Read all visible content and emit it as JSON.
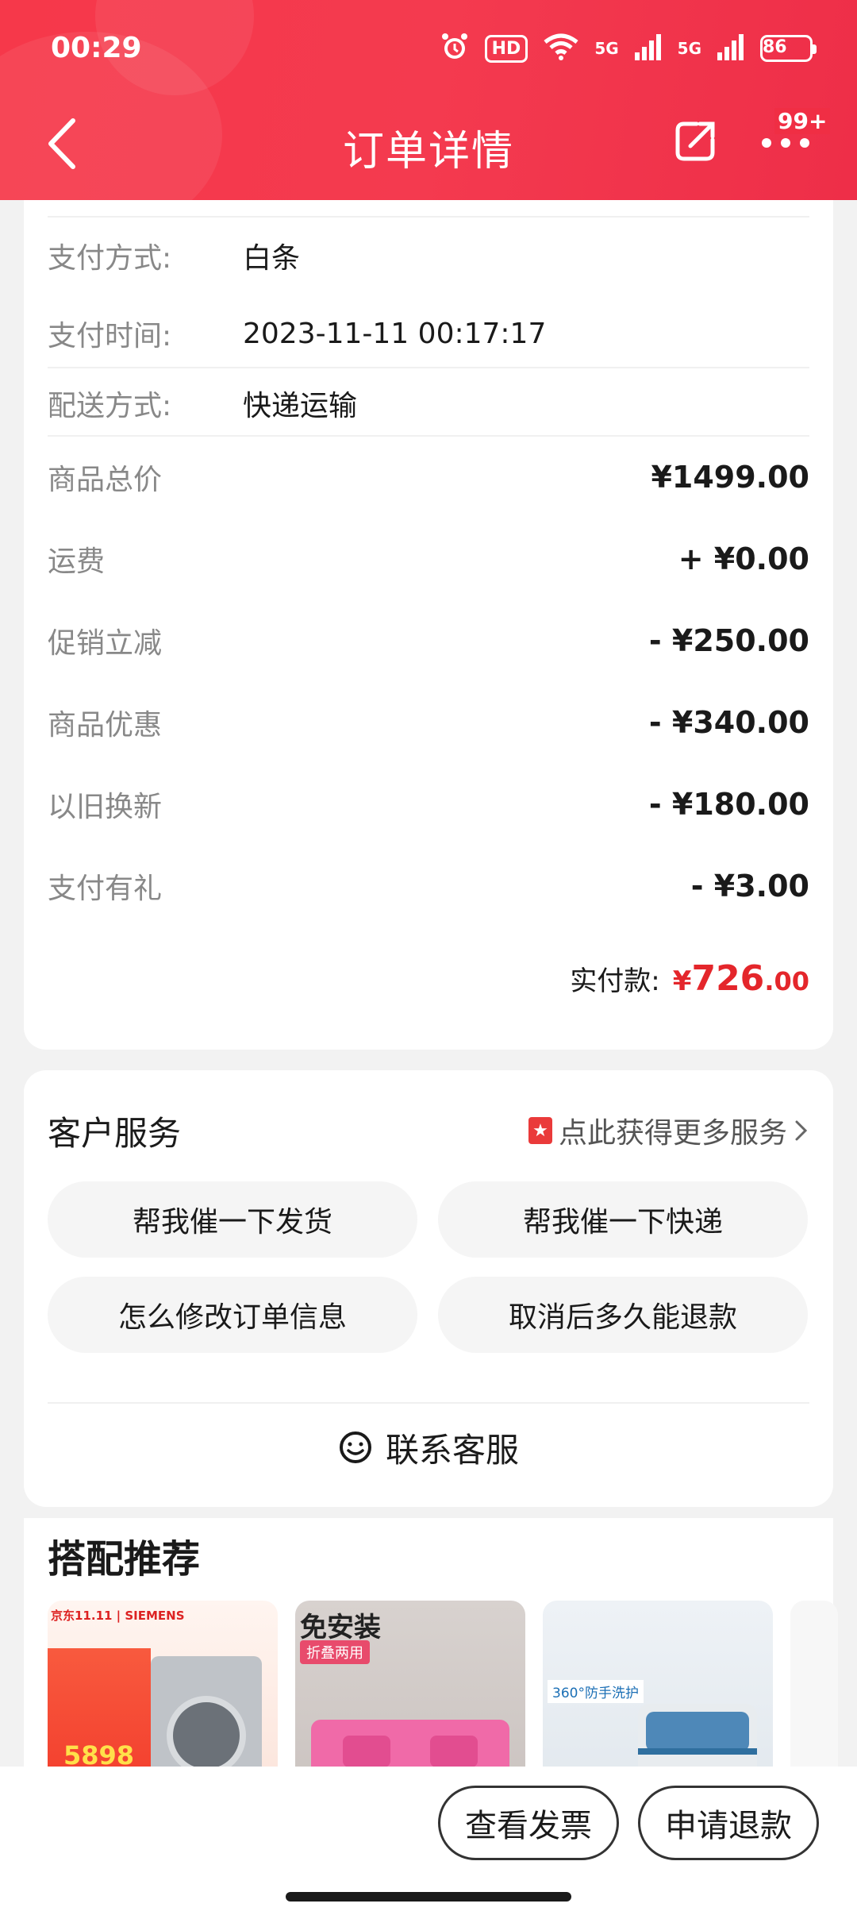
{
  "status_bar": {
    "time": "00:29",
    "hd_label": "HD",
    "net1": "5G",
    "net2": "5G",
    "battery": "86"
  },
  "nav": {
    "title": "订单详情",
    "badge": "99+"
  },
  "order_info": {
    "rows": [
      {
        "label": "支付方式:",
        "value": "白条"
      },
      {
        "label": "支付时间:",
        "value": "2023-11-11 00:17:17"
      },
      {
        "label": "配送方式:",
        "value": "快递运输"
      }
    ]
  },
  "price_breakdown": [
    {
      "label": "商品总价",
      "value": "¥1499.00"
    },
    {
      "label": "运费",
      "value": "+ ¥0.00"
    },
    {
      "label": "促销立减",
      "value": "- ¥250.00"
    },
    {
      "label": "商品优惠",
      "value": "- ¥340.00"
    },
    {
      "label": "以旧换新",
      "value": "- ¥180.00"
    },
    {
      "label": "支付有礼",
      "value": "- ¥3.00"
    }
  ],
  "total": {
    "label": "实付款:",
    "currency": "¥",
    "integer": "726",
    "decimal": ".00"
  },
  "customer_service": {
    "title": "客户服务",
    "more_label": "点此获得更多服务",
    "buttons": [
      "帮我催一下发货",
      "帮我催一下快递",
      "怎么修改订单信息",
      "取消后多久能退款"
    ],
    "contact_label": "联系客服"
  },
  "recommend": {
    "title": "搭配推荐",
    "items": [
      {
        "brand": "京东11.11 | SIEMENS",
        "tag": "5898"
      },
      {
        "brand": "免安装",
        "tag": "折叠两用"
      },
      {
        "brand": "360°防手洗护",
        "tag": ""
      }
    ]
  },
  "bottom": {
    "invoice_label": "查看发票",
    "refund_label": "申请退款"
  },
  "colors": {
    "header_red": "#f43a4f",
    "price_red": "#e4262b"
  }
}
